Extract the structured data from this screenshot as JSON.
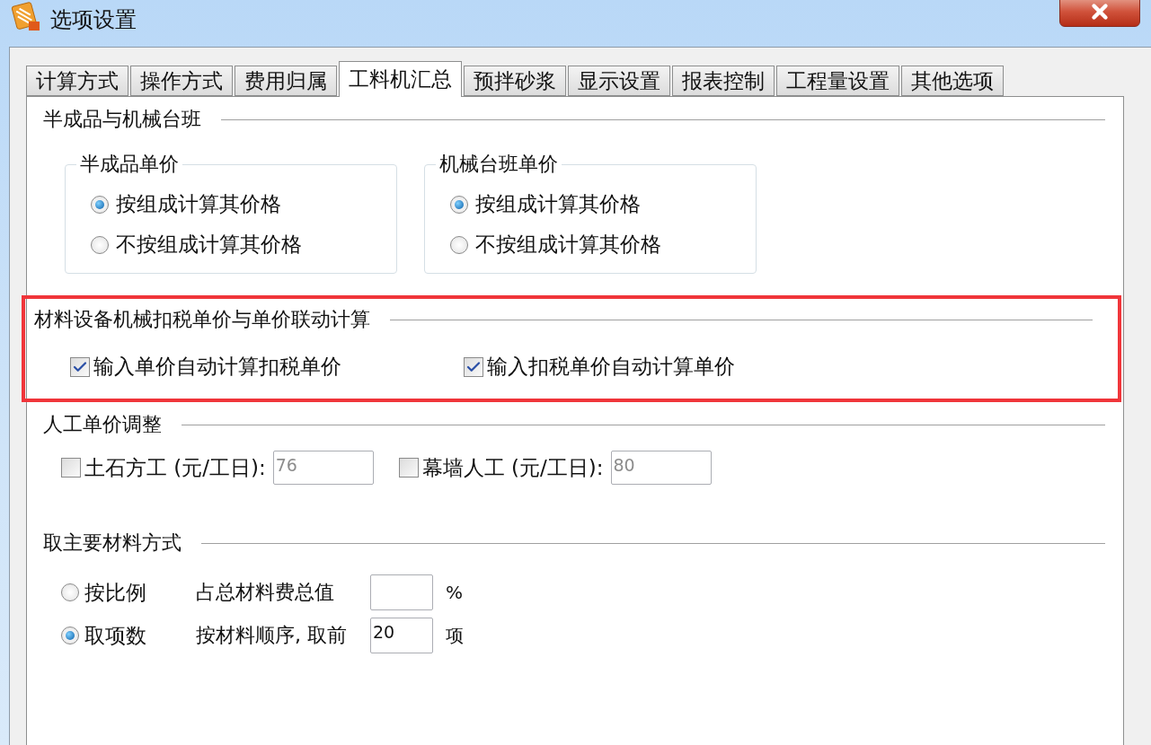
{
  "window": {
    "title": "选项设置"
  },
  "tabs": [
    {
      "label": "计算方式",
      "selected": false
    },
    {
      "label": "操作方式",
      "selected": false
    },
    {
      "label": "费用归属",
      "selected": false
    },
    {
      "label": "工料机汇总",
      "selected": true
    },
    {
      "label": "预拌砂浆",
      "selected": false
    },
    {
      "label": "显示设置",
      "selected": false
    },
    {
      "label": "报表控制",
      "selected": false
    },
    {
      "label": "工程量设置",
      "selected": false
    },
    {
      "label": "其他选项",
      "selected": false
    }
  ],
  "sections": [
    {
      "kind": "groups",
      "title": "半成品与机械台班",
      "groups": [
        {
          "title": "半成品单价",
          "options": [
            {
              "label": "按组成计算其价格",
              "selected": true
            },
            {
              "label": "不按组成计算其价格",
              "selected": false
            }
          ]
        },
        {
          "title": "机械台班单价",
          "options": [
            {
              "label": "按组成计算其价格",
              "selected": true
            },
            {
              "label": "不按组成计算其价格",
              "selected": false
            }
          ]
        }
      ]
    },
    {
      "kind": "checks",
      "title": "材料设备机械扣税单价与单价联动计算",
      "highlighted": true,
      "items": [
        {
          "label": "输入单价自动计算扣税单价",
          "checked": true
        },
        {
          "label": "输入扣税单价自动计算单价",
          "checked": true
        }
      ]
    },
    {
      "kind": "labor",
      "title": "人工单价调整",
      "items": [
        {
          "label": "土石方工 (元/工日):",
          "checked": false,
          "value": "76",
          "disabled": true
        },
        {
          "label": "幕墙人工 (元/工日):",
          "checked": false,
          "value": "80",
          "disabled": true
        }
      ]
    },
    {
      "kind": "material",
      "title": "取主要材料方式",
      "options": [
        {
          "label": "按比例",
          "selected": false,
          "prefix": "占总材料费总值",
          "suffix": "%"
        },
        {
          "label": "取项数",
          "selected": true,
          "prefix": "按材料顺序, 取前",
          "value": "20",
          "suffix": "项"
        }
      ]
    }
  ]
}
